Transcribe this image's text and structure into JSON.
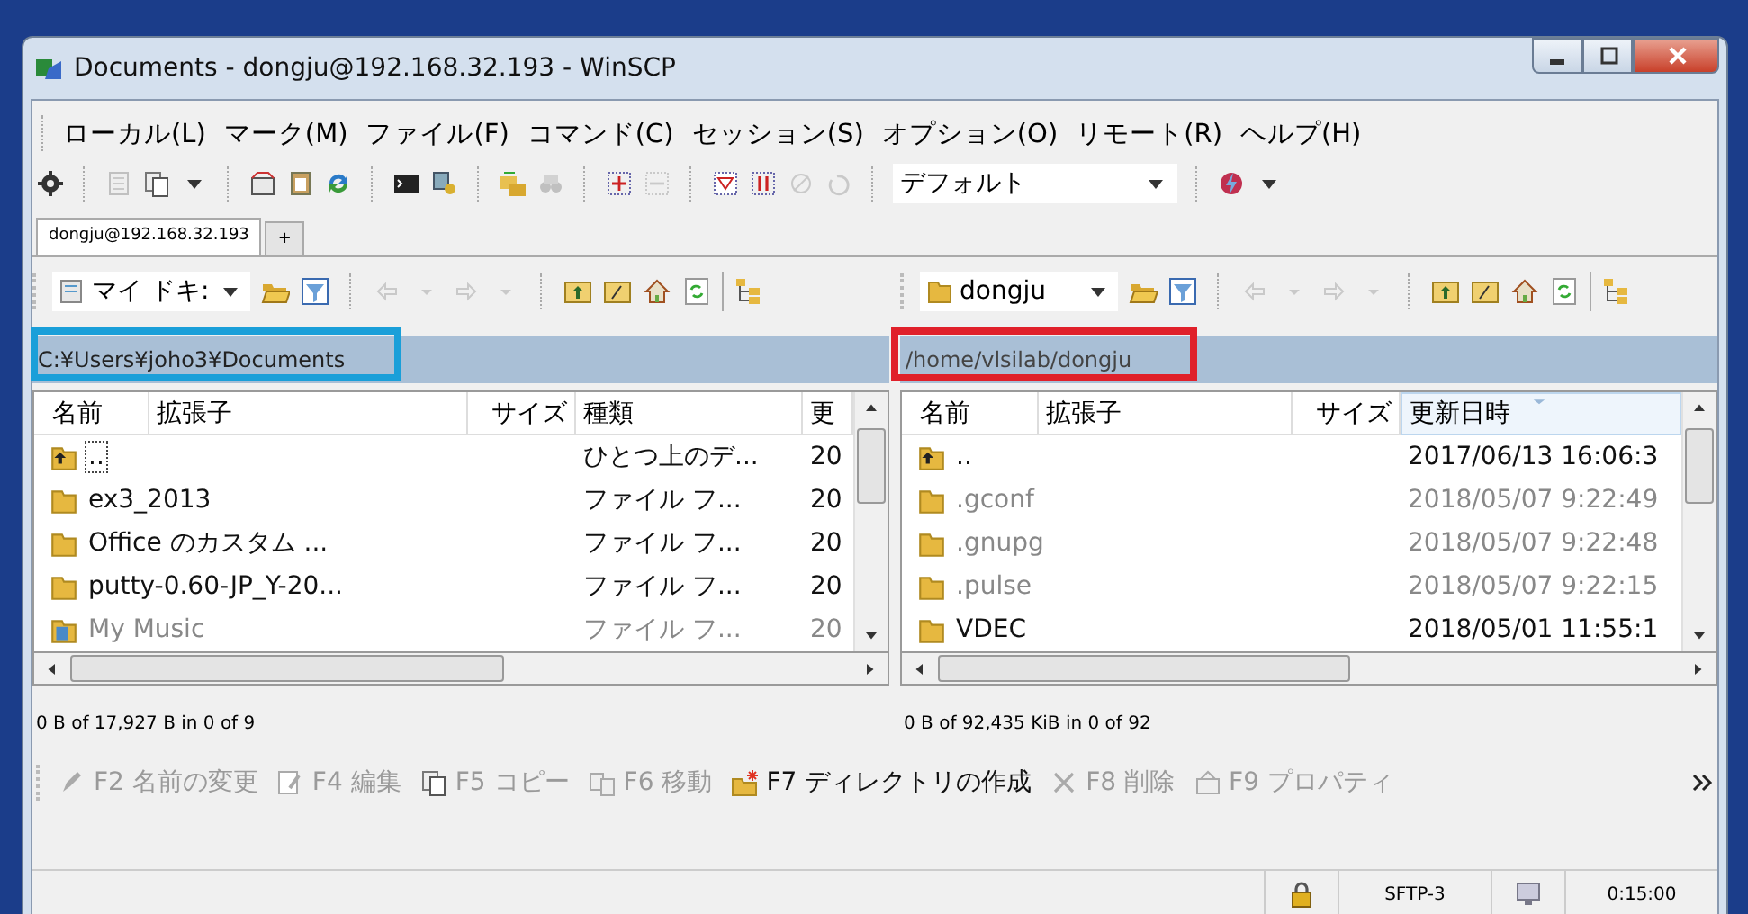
{
  "window": {
    "title": "Documents - dongju@192.168.32.193 - WinSCP"
  },
  "menu": [
    "ローカル(L)",
    "マーク(M)",
    "ファイル(F)",
    "コマンド(C)",
    "セッション(S)",
    "オプション(O)",
    "リモート(R)",
    "ヘルプ(H)"
  ],
  "toolbar": {
    "profile": "デフォルト"
  },
  "session_tabs": [
    {
      "label": "dongju@192.168.32.193",
      "selected": true
    },
    {
      "label": "+",
      "selected": false
    }
  ],
  "panels": [
    {
      "location": "マイ ドキ:",
      "kind": "document",
      "path": "C:¥Users¥joho3¥Documents",
      "color": "#1a9fd9",
      "columns": [
        {
          "label": "名前",
          "kind": "name",
          "sorted": false
        },
        {
          "label": "拡張子",
          "kind": "ext",
          "sorted": false
        },
        {
          "label": "サイズ",
          "kind": "size",
          "sorted": false
        },
        {
          "label": "種類",
          "kind": "type",
          "sorted": false
        },
        {
          "label": "更",
          "kind": "modified",
          "sorted": false
        }
      ],
      "rows": [
        {
          "kind": "parent",
          "name": "..",
          "type": "ひとつ上のデ...",
          "modified": "20",
          "dimmed": false,
          "focused": true
        },
        {
          "kind": "folder",
          "name": "ex3_2013",
          "type": "ファイル フ...",
          "modified": "20",
          "dimmed": false,
          "focused": false
        },
        {
          "kind": "folder",
          "name": "Office のカスタム ...",
          "type": "ファイル フ...",
          "modified": "20",
          "dimmed": false,
          "focused": false
        },
        {
          "kind": "folder",
          "name": "putty-0.60-JP_Y-20...",
          "type": "ファイル フ...",
          "modified": "20",
          "dimmed": false,
          "focused": false
        },
        {
          "kind": "special",
          "name": "My Music",
          "type": "ファイル フ...",
          "modified": "20",
          "dimmed": true,
          "focused": false
        }
      ],
      "status": "0 B of 17,927 B in 0 of 9"
    },
    {
      "location": "dongju",
      "kind": "folder",
      "path": "/home/vlsilab/dongju",
      "color": "#e0202a",
      "columns": [
        {
          "label": "名前",
          "kind": "name",
          "sorted": false
        },
        {
          "label": "拡張子",
          "kind": "ext",
          "sorted": false
        },
        {
          "label": "サイズ",
          "kind": "size",
          "sorted": false
        },
        {
          "label": "更新日時",
          "kind": "modified",
          "sorted": true
        }
      ],
      "rows": [
        {
          "kind": "parent",
          "name": "..",
          "modified": "2017/06/13 16:06:3",
          "dimmed": false,
          "focused": false
        },
        {
          "kind": "folder",
          "name": ".gconf",
          "modified": "2018/05/07 9:22:49",
          "dimmed": true,
          "focused": false
        },
        {
          "kind": "folder",
          "name": ".gnupg",
          "modified": "2018/05/07 9:22:48",
          "dimmed": true,
          "focused": false
        },
        {
          "kind": "folder",
          "name": ".pulse",
          "modified": "2018/05/07 9:22:15",
          "dimmed": true,
          "focused": false
        },
        {
          "kind": "folder",
          "name": "VDEC",
          "modified": "2018/05/01 11:55:1",
          "dimmed": false,
          "focused": false
        }
      ],
      "status": "0 B of 92,435 KiB in 0 of 92"
    }
  ],
  "commands": [
    {
      "kind": "rename",
      "label": "F2 名前の変更",
      "disabled": true
    },
    {
      "kind": "edit",
      "label": "F4 編集",
      "disabled": true
    },
    {
      "kind": "copy",
      "label": "F5 コピー",
      "disabled": true
    },
    {
      "kind": "move",
      "label": "F6 移動",
      "disabled": true
    },
    {
      "kind": "mkdir",
      "label": "F7 ディレクトリの作成",
      "disabled": false
    },
    {
      "kind": "delete",
      "label": "F8 削除",
      "disabled": true
    },
    {
      "kind": "properties",
      "label": "F9 プロパティ",
      "disabled": true
    }
  ],
  "status_bar": {
    "protocol": "SFTP-3",
    "elapsed": "0:15:00"
  }
}
